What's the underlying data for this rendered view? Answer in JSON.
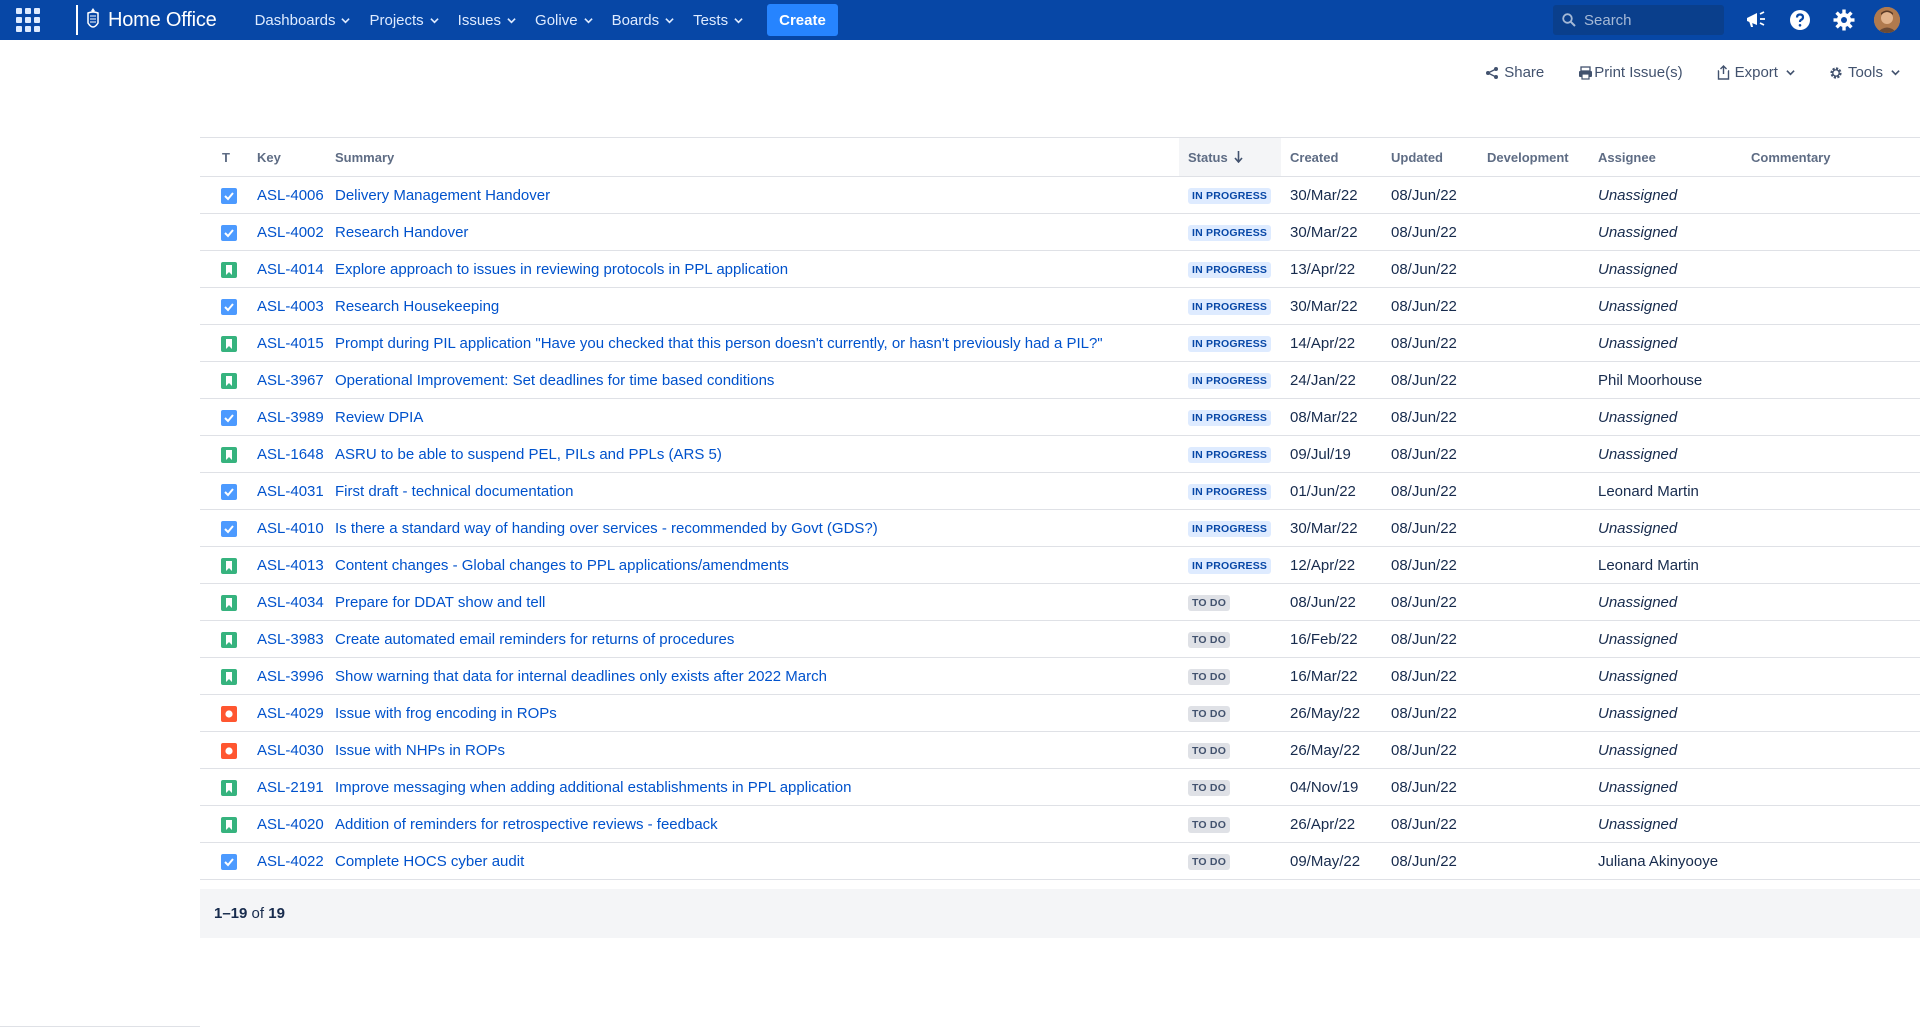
{
  "header": {
    "brand": "Home Office",
    "nav": [
      {
        "label": "Dashboards"
      },
      {
        "label": "Projects"
      },
      {
        "label": "Issues"
      },
      {
        "label": "Golive"
      },
      {
        "label": "Boards"
      },
      {
        "label": "Tests"
      }
    ],
    "create_label": "Create",
    "search_placeholder": "Search",
    "accent": "#0747a6"
  },
  "toolbar": {
    "share": "Share",
    "print": "Print Issue(s)",
    "export": "Export",
    "tools": "Tools"
  },
  "table": {
    "columns": [
      "T",
      "Key",
      "Summary",
      "Status",
      "Created",
      "Updated",
      "Development",
      "Assignee",
      "Commentary"
    ],
    "sorted_column": "Status",
    "rows": [
      {
        "type": "task",
        "key": "ASL-4006",
        "summary": "Delivery Management Handover",
        "status": "IN PROGRESS",
        "created": "30/Mar/22",
        "updated": "08/Jun/22",
        "development": "",
        "assignee": "Unassigned",
        "commentary": ""
      },
      {
        "type": "task",
        "key": "ASL-4002",
        "summary": "Research Handover",
        "status": "IN PROGRESS",
        "created": "30/Mar/22",
        "updated": "08/Jun/22",
        "development": "",
        "assignee": "Unassigned",
        "commentary": ""
      },
      {
        "type": "story",
        "key": "ASL-4014",
        "summary": "Explore approach to issues in reviewing protocols in PPL application",
        "status": "IN PROGRESS",
        "created": "13/Apr/22",
        "updated": "08/Jun/22",
        "development": "",
        "assignee": "Unassigned",
        "commentary": ""
      },
      {
        "type": "task",
        "key": "ASL-4003",
        "summary": "Research Housekeeping",
        "status": "IN PROGRESS",
        "created": "30/Mar/22",
        "updated": "08/Jun/22",
        "development": "",
        "assignee": "Unassigned",
        "commentary": ""
      },
      {
        "type": "story",
        "key": "ASL-4015",
        "summary": "Prompt during PIL application \"Have you checked that this person doesn't currently, or hasn't previously had a PIL?\"",
        "status": "IN PROGRESS",
        "created": "14/Apr/22",
        "updated": "08/Jun/22",
        "development": "",
        "assignee": "Unassigned",
        "commentary": ""
      },
      {
        "type": "story",
        "key": "ASL-3967",
        "summary": "Operational Improvement: Set deadlines for time based conditions",
        "status": "IN PROGRESS",
        "created": "24/Jan/22",
        "updated": "08/Jun/22",
        "development": "",
        "assignee": "Phil Moorhouse",
        "commentary": ""
      },
      {
        "type": "task",
        "key": "ASL-3989",
        "summary": "Review DPIA",
        "status": "IN PROGRESS",
        "created": "08/Mar/22",
        "updated": "08/Jun/22",
        "development": "",
        "assignee": "Unassigned",
        "commentary": ""
      },
      {
        "type": "story",
        "key": "ASL-1648",
        "summary": "ASRU to be able to suspend PEL, PILs and PPLs (ARS 5)",
        "status": "IN PROGRESS",
        "created": "09/Jul/19",
        "updated": "08/Jun/22",
        "development": "",
        "assignee": "Unassigned",
        "commentary": ""
      },
      {
        "type": "task",
        "key": "ASL-4031",
        "summary": "First draft - technical documentation",
        "status": "IN PROGRESS",
        "created": "01/Jun/22",
        "updated": "08/Jun/22",
        "development": "",
        "assignee": "Leonard Martin",
        "commentary": ""
      },
      {
        "type": "task",
        "key": "ASL-4010",
        "summary": "Is there a standard way of handing over services - recommended by Govt (GDS?)",
        "status": "IN PROGRESS",
        "created": "30/Mar/22",
        "updated": "08/Jun/22",
        "development": "",
        "assignee": "Unassigned",
        "commentary": ""
      },
      {
        "type": "story",
        "key": "ASL-4013",
        "summary": "Content changes - Global changes to PPL applications/amendments",
        "status": "IN PROGRESS",
        "created": "12/Apr/22",
        "updated": "08/Jun/22",
        "development": "",
        "assignee": "Leonard Martin",
        "commentary": ""
      },
      {
        "type": "story",
        "key": "ASL-4034",
        "summary": "Prepare for DDAT show and tell",
        "status": "TO DO",
        "created": "08/Jun/22",
        "updated": "08/Jun/22",
        "development": "",
        "assignee": "Unassigned",
        "commentary": ""
      },
      {
        "type": "story",
        "key": "ASL-3983",
        "summary": "Create automated email reminders for returns of procedures",
        "status": "TO DO",
        "created": "16/Feb/22",
        "updated": "08/Jun/22",
        "development": "",
        "assignee": "Unassigned",
        "commentary": ""
      },
      {
        "type": "story",
        "key": "ASL-3996",
        "summary": "Show warning that data for internal deadlines only exists after 2022 March",
        "status": "TO DO",
        "created": "16/Mar/22",
        "updated": "08/Jun/22",
        "development": "",
        "assignee": "Unassigned",
        "commentary": ""
      },
      {
        "type": "bug",
        "key": "ASL-4029",
        "summary": "Issue with frog encoding in ROPs",
        "status": "TO DO",
        "created": "26/May/22",
        "updated": "08/Jun/22",
        "development": "",
        "assignee": "Unassigned",
        "commentary": ""
      },
      {
        "type": "bug",
        "key": "ASL-4030",
        "summary": "Issue with NHPs in ROPs",
        "status": "TO DO",
        "created": "26/May/22",
        "updated": "08/Jun/22",
        "development": "",
        "assignee": "Unassigned",
        "commentary": ""
      },
      {
        "type": "story",
        "key": "ASL-2191",
        "summary": "Improve messaging when adding additional establishments in PPL application",
        "status": "TO DO",
        "created": "04/Nov/19",
        "updated": "08/Jun/22",
        "development": "",
        "assignee": "Unassigned",
        "commentary": ""
      },
      {
        "type": "story",
        "key": "ASL-4020",
        "summary": "Addition of reminders for retrospective reviews - feedback",
        "status": "TO DO",
        "created": "26/Apr/22",
        "updated": "08/Jun/22",
        "development": "",
        "assignee": "Unassigned",
        "commentary": ""
      },
      {
        "type": "task",
        "key": "ASL-4022",
        "summary": "Complete HOCS cyber audit",
        "status": "TO DO",
        "created": "09/May/22",
        "updated": "08/Jun/22",
        "development": "",
        "assignee": "Juliana Akinyooye",
        "commentary": ""
      }
    ]
  },
  "pager": {
    "range": "1–19",
    "of": "of",
    "total": "19"
  },
  "icons": {
    "task": "checkbox-task-icon",
    "story": "bookmark-story-icon",
    "bug": "bug-icon"
  }
}
